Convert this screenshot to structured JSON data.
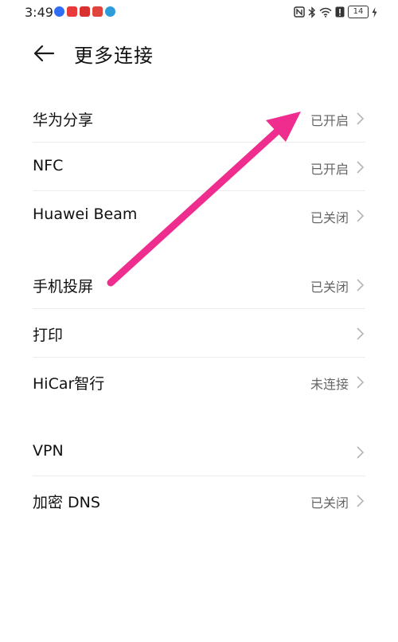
{
  "status_bar": {
    "time": "3:49",
    "battery_level": "14",
    "notification_icons": [
      {
        "name": "browser-notif-icon",
        "color": "#2f6df6"
      },
      {
        "name": "app-red-notif-icon",
        "color": "#e83a3a"
      },
      {
        "name": "mail-notif-icon",
        "color": "#d93030"
      },
      {
        "name": "app-red2-notif-icon",
        "color": "#e0443d"
      },
      {
        "name": "app-blue-notif-icon",
        "color": "#2d9cdb"
      }
    ]
  },
  "header": {
    "title": "更多连接"
  },
  "groups": [
    {
      "items": [
        {
          "label": "华为分享",
          "value": "已开启"
        },
        {
          "label": "NFC",
          "value": "已开启"
        },
        {
          "label": "Huawei Beam",
          "value": "已关闭"
        }
      ]
    },
    {
      "items": [
        {
          "label": "手机投屏",
          "value": "已关闭"
        },
        {
          "label": "打印",
          "value": ""
        },
        {
          "label": "HiCar智行",
          "value": "未连接"
        }
      ]
    },
    {
      "items": [
        {
          "label": "VPN",
          "value": ""
        },
        {
          "label": "加密 DNS",
          "value": "已关闭"
        }
      ]
    }
  ],
  "colors": {
    "annotation_arrow": "#ee2d8f",
    "value_text": "#666666",
    "chevron": "#b5b5b5"
  }
}
